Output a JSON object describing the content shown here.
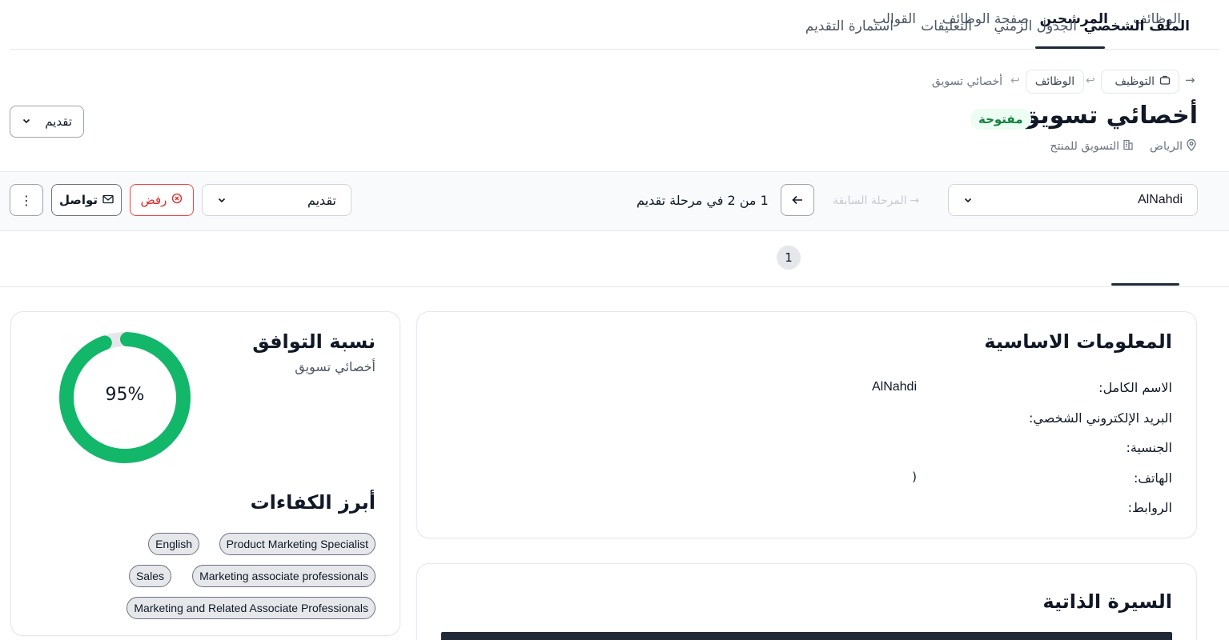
{
  "topnav": {
    "items": [
      {
        "label": "الوظائف"
      },
      {
        "label": "المرشحين"
      },
      {
        "label": "صفحة الوظائف"
      },
      {
        "label": "القوالب"
      }
    ]
  },
  "breadcrumb": {
    "root": "التوظيف",
    "jobs": "الوظائف",
    "current": "أخصائي تسويق",
    "sep": "↩"
  },
  "job": {
    "title": "أخصائي تسويق",
    "status": "مفتوحة",
    "location": "الرياض",
    "department": "التسويق للمنتج",
    "stage_select": "تقديم"
  },
  "toolbar": {
    "candidate_select": "AlNahdi",
    "prev_stage": "المرحلة السابقة",
    "stage_count": "1 من 2 في مرحلة تقديم",
    "stage_dropdown": "تقديم",
    "reject": "رفض",
    "contact": "تواصل",
    "more": "⋮"
  },
  "tabs": [
    {
      "label": "الملف الشخصي"
    },
    {
      "label": "الجدول الزمني"
    },
    {
      "label": "التعليقات"
    },
    {
      "label": "استمارة التقديم",
      "count": "1"
    }
  ],
  "basic_info": {
    "title": "المعلومات الاساسية",
    "rows": [
      {
        "label": "الاسم الكامل:",
        "value": "AlNahdi"
      },
      {
        "label": "البريد الإلكتروني الشخصي:",
        "value": ""
      },
      {
        "label": "الجنسية:",
        "value": ""
      },
      {
        "label": "الهاتف:",
        "value": ")"
      },
      {
        "label": "الروابط:",
        "value": ""
      }
    ]
  },
  "match": {
    "title": "نسبة التوافق",
    "subtitle": "أخصائي تسويق",
    "percent_label": "95%",
    "percent": 95,
    "color": "#12b76a",
    "track_color": "#e5e7eb"
  },
  "skills": {
    "title": "أبرز الكفاءات",
    "rows": [
      [
        "Product Marketing Specialist",
        "English"
      ],
      [
        "Marketing associate professionals",
        "Sales"
      ],
      [
        "Marketing and Related Associate Professionals"
      ]
    ]
  },
  "resume": {
    "title": "السيرة الذاتية"
  },
  "icons": {
    "briefcase": "briefcase-icon",
    "location": "location-pin-icon",
    "building": "building-icon",
    "chevron": "chevron-down-icon",
    "arrow": "arrow-left-icon",
    "reject": "x-circle-icon",
    "mail": "mail-icon"
  }
}
